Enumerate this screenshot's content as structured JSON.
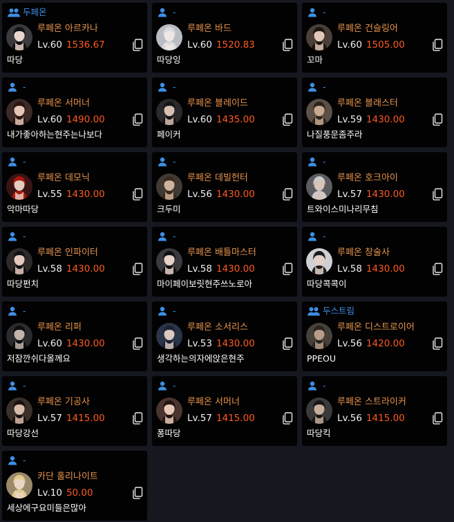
{
  "colors": {
    "guild": "#3d8fe6",
    "class": "#e8944a",
    "item_level": "#ff5a1f",
    "background": "#15181f",
    "card": "#020203"
  },
  "characters": [
    {
      "guild": "두페온",
      "guild_icon": "group-icon",
      "server": "루페온",
      "class": "아르카나",
      "level": "Lv.60",
      "item_level": "1536.67",
      "name": "따당",
      "portrait": "arcana-portrait"
    },
    {
      "guild": "-",
      "guild_icon": "person-icon",
      "server": "루페온",
      "class": "바드",
      "level": "Lv.60",
      "item_level": "1520.83",
      "name": "따당잉",
      "portrait": "bard-portrait"
    },
    {
      "guild": "-",
      "guild_icon": "person-icon",
      "server": "루페온",
      "class": "건슬링어",
      "level": "Lv.60",
      "item_level": "1505.00",
      "name": "꼬마",
      "portrait": "gunslinger-portrait"
    },
    {
      "guild": "-",
      "guild_icon": "person-icon",
      "server": "루페온",
      "class": "서머너",
      "level": "Lv.60",
      "item_level": "1490.00",
      "name": "내가좋아하는현주는나보다",
      "portrait": "summoner-portrait"
    },
    {
      "guild": "-",
      "guild_icon": "person-icon",
      "server": "루페온",
      "class": "블레이드",
      "level": "Lv.60",
      "item_level": "1435.00",
      "name": "페이커",
      "portrait": "blade-portrait"
    },
    {
      "guild": "-",
      "guild_icon": "person-icon",
      "server": "루페온",
      "class": "블래스터",
      "level": "Lv.59",
      "item_level": "1430.00",
      "name": "나질풍문좀주라",
      "portrait": "blaster-portrait"
    },
    {
      "guild": "-",
      "guild_icon": "person-icon",
      "server": "루페온",
      "class": "데모닉",
      "level": "Lv.55",
      "item_level": "1430.00",
      "name": "악마따당",
      "portrait": "demonic-portrait"
    },
    {
      "guild": "-",
      "guild_icon": "person-icon",
      "server": "루페온",
      "class": "데빌헌터",
      "level": "Lv.56",
      "item_level": "1430.00",
      "name": "크두미",
      "portrait": "devilhunter-portrait"
    },
    {
      "guild": "-",
      "guild_icon": "person-icon",
      "server": "루페온",
      "class": "호크아이",
      "level": "Lv.57",
      "item_level": "1430.00",
      "name": "트와이스미나리무침",
      "portrait": "hawkeye-portrait"
    },
    {
      "guild": "-",
      "guild_icon": "person-icon",
      "server": "루페온",
      "class": "인파이터",
      "level": "Lv.58",
      "item_level": "1430.00",
      "name": "따당펀치",
      "portrait": "infighter-portrait"
    },
    {
      "guild": "-",
      "guild_icon": "person-icon",
      "server": "루페온",
      "class": "배틀마스터",
      "level": "Lv.58",
      "item_level": "1430.00",
      "name": "마이페이보릿현주쓰노로아",
      "portrait": "battlemaster-portrait"
    },
    {
      "guild": "-",
      "guild_icon": "person-icon",
      "server": "루페온",
      "class": "창술사",
      "level": "Lv.58",
      "item_level": "1430.00",
      "name": "따당콕콕이",
      "portrait": "lancemaster-portrait"
    },
    {
      "guild": "-",
      "guild_icon": "person-icon",
      "server": "루페온",
      "class": "리퍼",
      "level": "Lv.60",
      "item_level": "1430.00",
      "name": "저잠깐쉬다올께요",
      "portrait": "reaper-portrait"
    },
    {
      "guild": "-",
      "guild_icon": "person-icon",
      "server": "루페온",
      "class": "소서리스",
      "level": "Lv.53",
      "item_level": "1430.00",
      "name": "생각하는의자에앉은현주",
      "portrait": "sorceress-portrait"
    },
    {
      "guild": "두스트림",
      "guild_icon": "group-icon",
      "server": "루페온",
      "class": "디스트로이어",
      "level": "Lv.56",
      "item_level": "1420.00",
      "name": "PPEOU",
      "portrait": "destroyer-portrait"
    },
    {
      "guild": "-",
      "guild_icon": "person-icon",
      "server": "루페온",
      "class": "기공사",
      "level": "Lv.57",
      "item_level": "1415.00",
      "name": "따당강선",
      "portrait": "soulfist-portrait"
    },
    {
      "guild": "-",
      "guild_icon": "person-icon",
      "server": "루페온",
      "class": "서머너",
      "level": "Lv.57",
      "item_level": "1415.00",
      "name": "퐁따당",
      "portrait": "summoner2-portrait"
    },
    {
      "guild": "-",
      "guild_icon": "person-icon",
      "server": "루페온",
      "class": "스트라이커",
      "level": "Lv.56",
      "item_level": "1415.00",
      "name": "따당킥",
      "portrait": "striker-portrait"
    },
    {
      "guild": "-",
      "guild_icon": "person-icon",
      "server": "카단",
      "class": "홀리나이트",
      "level": "Lv.10",
      "item_level": "50.00",
      "name": "세상에구요미들은많아",
      "portrait": "holyknight-portrait"
    }
  ]
}
